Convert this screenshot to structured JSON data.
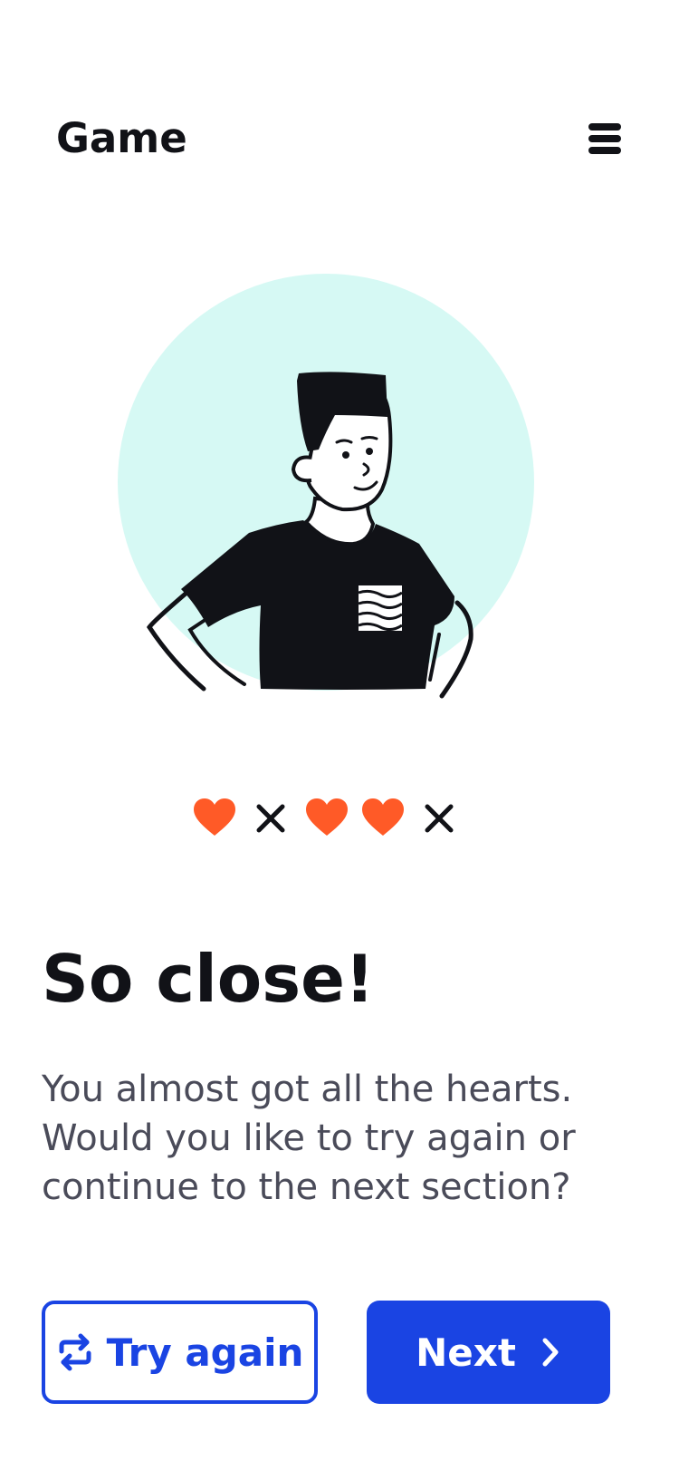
{
  "header": {
    "title": "Game",
    "menu_icon": "hamburger-menu-icon"
  },
  "illustration": {
    "name": "man-hands-on-hips-illustration",
    "background_color": "#d6f9f4"
  },
  "lives": [
    {
      "state": "heart"
    },
    {
      "state": "lost"
    },
    {
      "state": "heart"
    },
    {
      "state": "heart"
    },
    {
      "state": "lost"
    }
  ],
  "colors": {
    "heart": "#ff5a27",
    "accent": "#1a44e3",
    "text": "#111217",
    "muted_text": "#4a4b59"
  },
  "result": {
    "title": "So close!",
    "message": "You almost got all the hearts. Would you like to try again or continue to the next section?"
  },
  "actions": {
    "try_again_label": "Try again",
    "try_again_icon": "repeat-icon",
    "next_label": "Next",
    "next_icon": "chevron-right-icon"
  }
}
